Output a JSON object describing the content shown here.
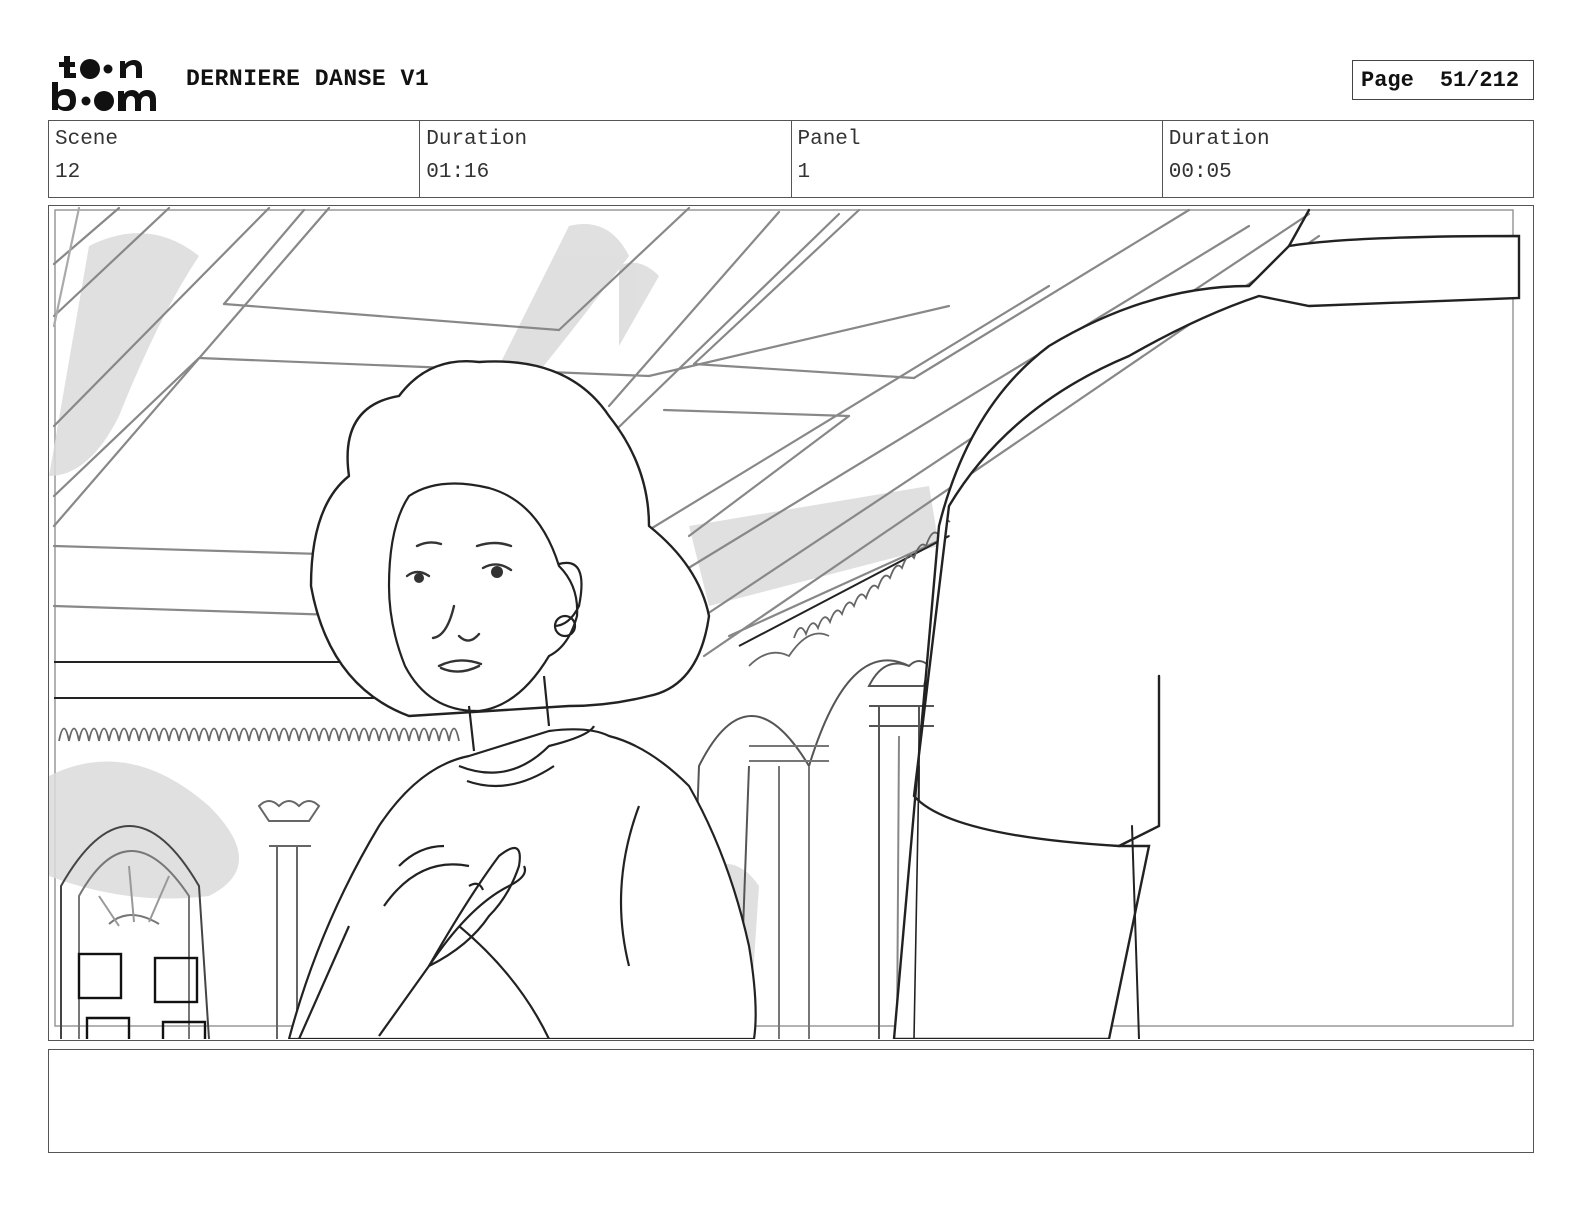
{
  "header": {
    "logo_text_top": "toon",
    "logo_text_bottom": "boom",
    "project_title": "DERNIERE DANSE V1",
    "page_label": "Page",
    "page_value": "51/212"
  },
  "info": {
    "scene_label": "Scene",
    "scene_value": "12",
    "scene_duration_label": "Duration",
    "scene_duration_value": "01:16",
    "panel_label": "Panel",
    "panel_value": "1",
    "panel_duration_label": "Duration",
    "panel_duration_value": "00:05"
  },
  "panel_image": {
    "icon": "storyboard-sketch-icon"
  },
  "notes": {
    "text": ""
  }
}
